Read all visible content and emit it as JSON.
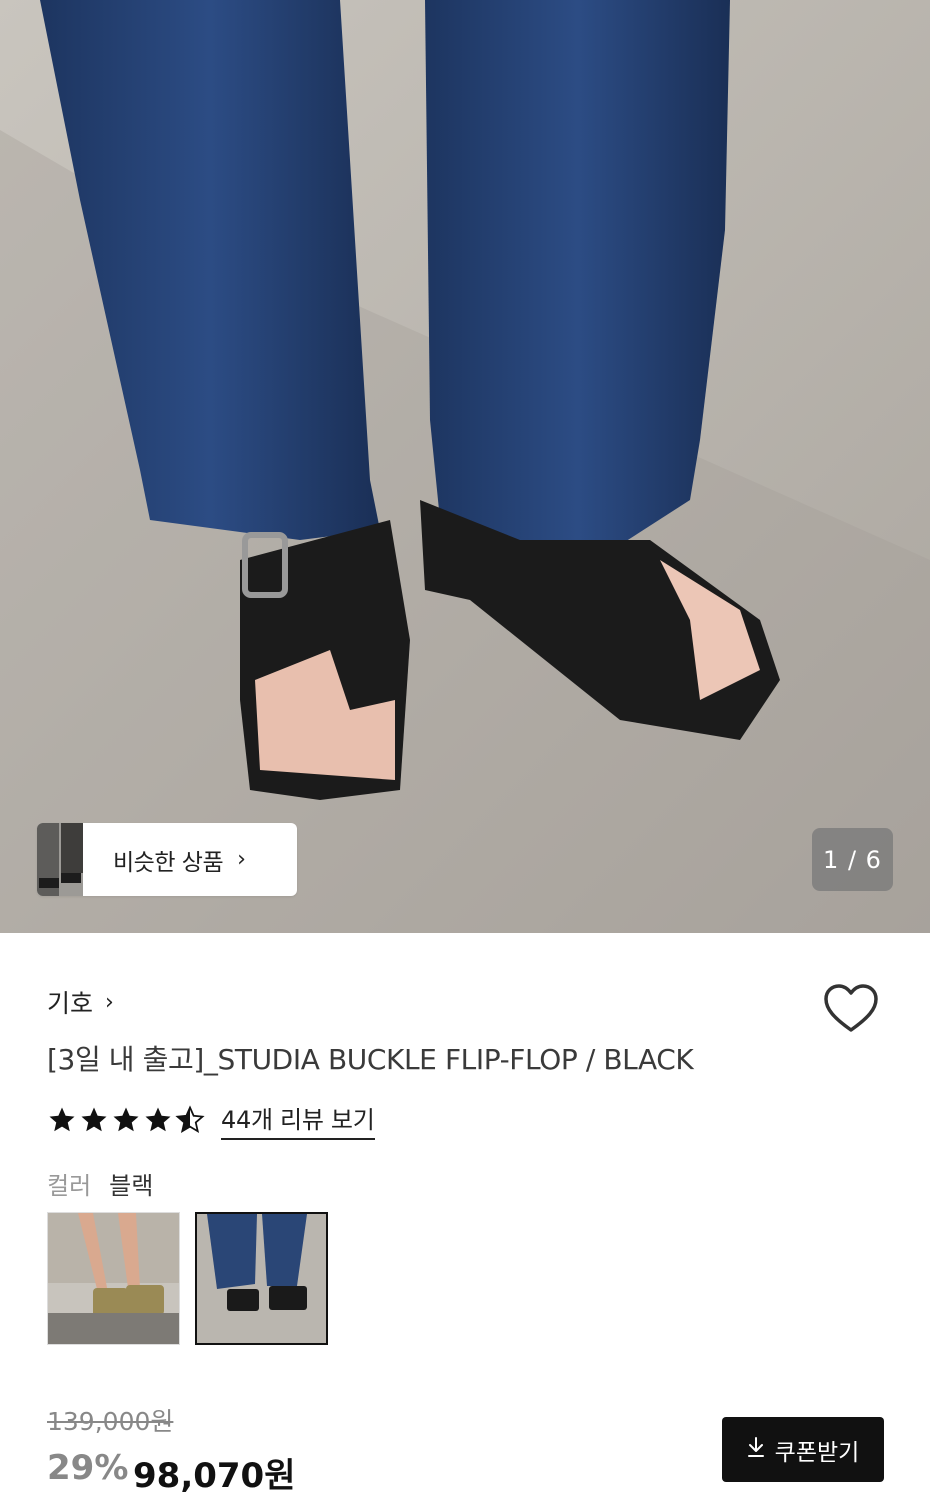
{
  "hero": {
    "similar_label": "비슷한 상품",
    "chevron": "›",
    "counter": "1 / 6"
  },
  "product": {
    "brand": "기호",
    "brand_chevron": "›",
    "title": "[3일 내 출고]_STUDIA BUCKLE FLIP-FLOP / BLACK",
    "rating": 4.5,
    "review_link": "44개 리뷰 보기",
    "color_label": "컬러",
    "color_value": "블랙"
  },
  "price": {
    "original": "139,000원",
    "discount": "29%",
    "final": "98,070원"
  },
  "coupon": {
    "label": "쿠폰받기",
    "icon": "download-icon"
  },
  "icons": {
    "heart": "heart-outline-icon",
    "star": "star-icon"
  }
}
